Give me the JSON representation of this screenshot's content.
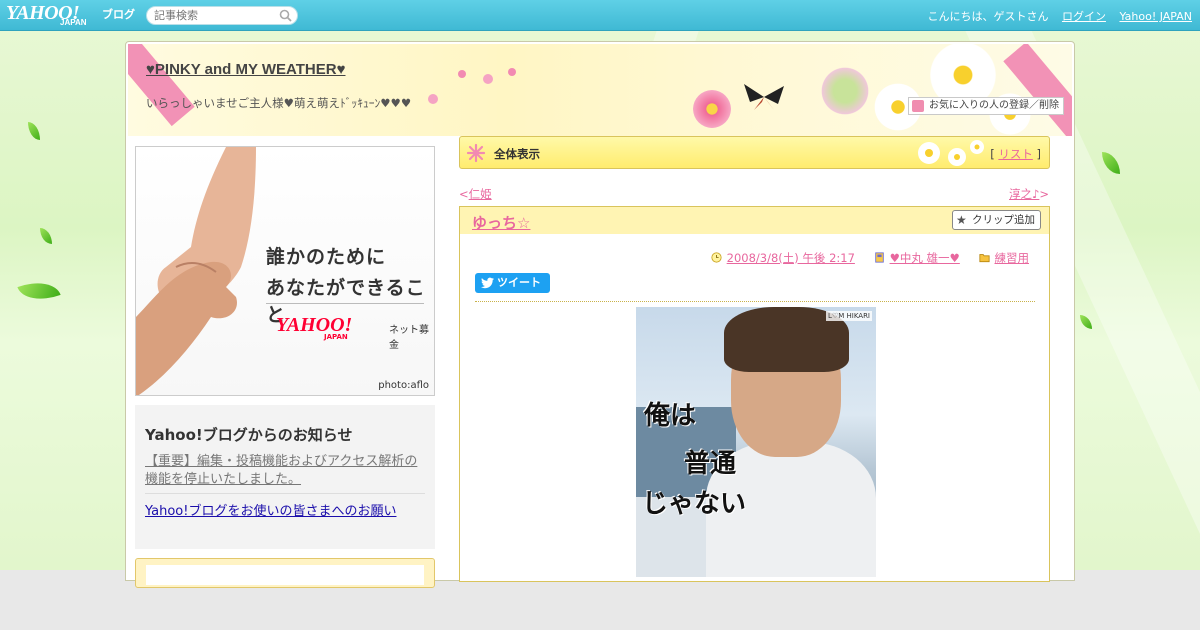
{
  "topbar": {
    "logo_main": "YAHOO!",
    "logo_sub": "JAPAN",
    "logo_blog": "ブログ",
    "search_placeholder": "記事検索",
    "greeting": "こんにちは、ゲストさん",
    "login": "ログイン",
    "yahoo_japan": "Yahoo! JAPAN"
  },
  "header": {
    "title": "♥PINKY and MY WEATHER♥",
    "subtitle": "いらっしゃいませご主人様♥萌え萌えﾄﾞｯｷｭｰﾝ♥♥♥",
    "favorite_button": "お気に入りの人の登録／削除"
  },
  "sidebar": {
    "ad": {
      "line1": "誰かのために",
      "line2": "あなたができること",
      "logo": "YAHOO!",
      "logo_sub": "JAPAN",
      "tag": "ネット募金",
      "credit": "photo:aflo"
    },
    "notice": {
      "title": "Yahoo!ブログからのお知らせ",
      "link1": "【重要】編集・投稿機能およびアクセス解析の機能を停止いたしました。",
      "link2": "Yahoo!ブログをお使いの皆さまへのお願い"
    }
  },
  "main": {
    "view_label": "全体表示",
    "list_open": "[",
    "list_label": "リスト",
    "list_close": "]",
    "prev_prefix": "<",
    "prev_link": "仁姫",
    "next_link": "淳之♪",
    "next_suffix": ">",
    "article": {
      "title": "ゆっち☆",
      "clip_button": "クリップ追加",
      "date": "2008/3/8(土) 午後 2:17",
      "author": "♥中丸 雄一♥",
      "category": "練習用",
      "tweet": "ツイート",
      "photo_text": [
        "俺は",
        "普通",
        "じゃない"
      ],
      "photo_badge": "L♡M HIKARI"
    }
  },
  "colors": {
    "topbar": "#3fb9d4",
    "link_pink": "#e8679e",
    "panel_yellow": "#fff4b3",
    "tweet_blue": "#1da1f2"
  }
}
